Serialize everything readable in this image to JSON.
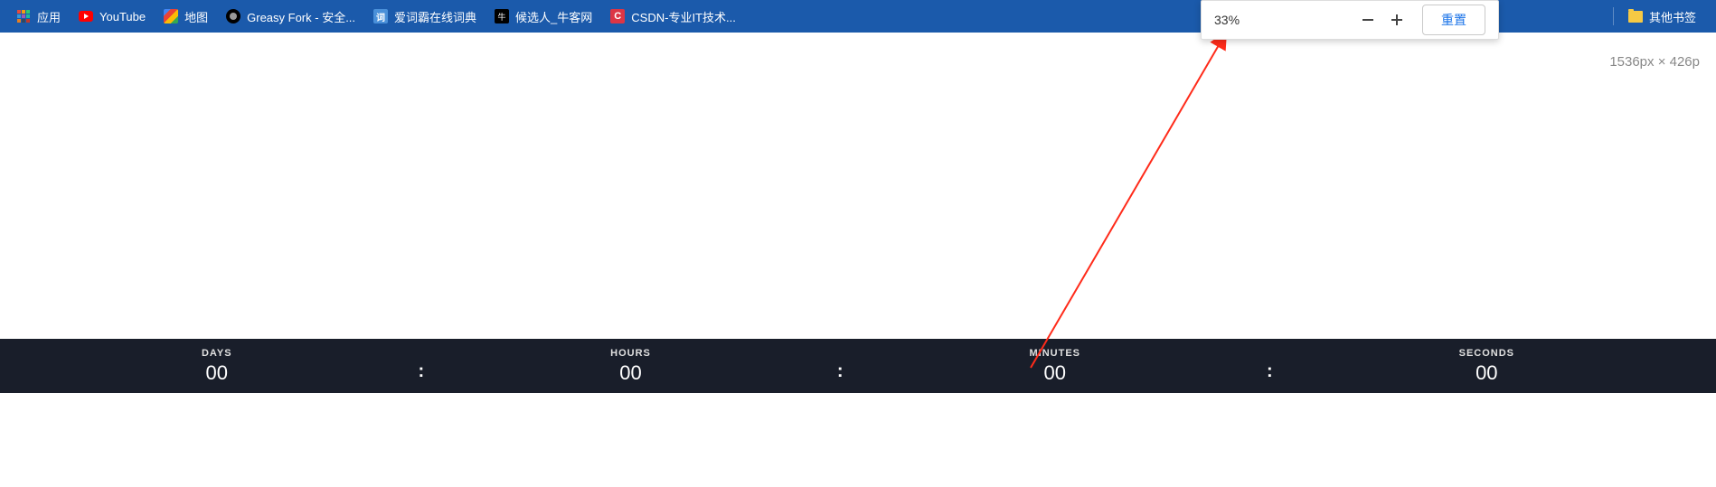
{
  "bookmarks": {
    "apps_label": "应用",
    "items": [
      {
        "label": "YouTube",
        "icon": "youtube-icon"
      },
      {
        "label": "地图",
        "icon": "maps-icon"
      },
      {
        "label": "Greasy Fork - 安全...",
        "icon": "greasy-icon"
      },
      {
        "label": "爱词霸在线词典",
        "icon": "dict-icon"
      },
      {
        "label": "候选人_牛客网",
        "icon": "nowcoder-icon"
      },
      {
        "label": "CSDN-专业IT技术...",
        "icon": "csdn-icon"
      }
    ],
    "other_label": "其他书签"
  },
  "zoom": {
    "level": "33%",
    "reset_label": "重置"
  },
  "dimension": "1536px × 426p",
  "countdown": {
    "units": [
      {
        "label": "DAYS",
        "value": "00"
      },
      {
        "label": "HOURS",
        "value": "00"
      },
      {
        "label": "MINUTES",
        "value": "00"
      },
      {
        "label": "SECONDS",
        "value": "00"
      }
    ],
    "separator": ":"
  }
}
